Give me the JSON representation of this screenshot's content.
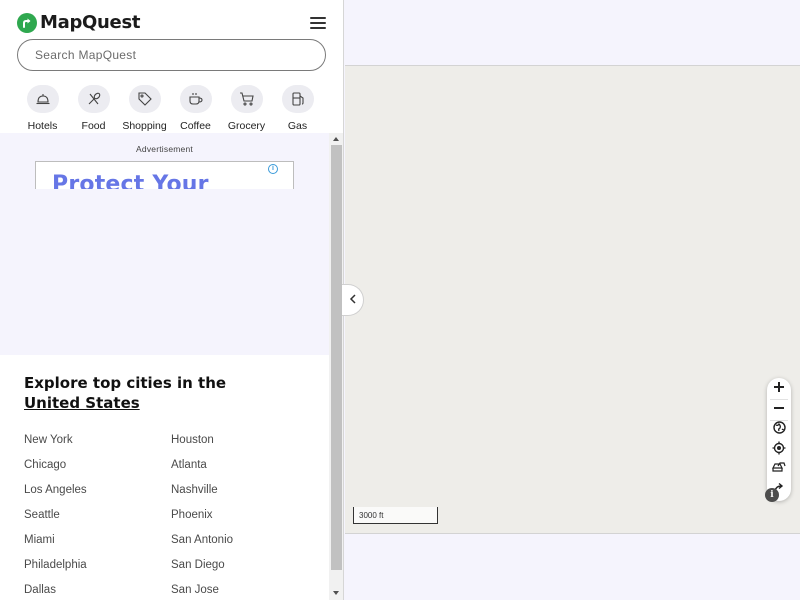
{
  "brand": {
    "name": "MapQuest",
    "color": "#2fa84f"
  },
  "search": {
    "placeholder": "Search MapQuest"
  },
  "categories": [
    {
      "label": "Hotels",
      "icon": "bell-icon"
    },
    {
      "label": "Food",
      "icon": "utensils-icon"
    },
    {
      "label": "Shopping",
      "icon": "tag-icon"
    },
    {
      "label": "Coffee",
      "icon": "coffee-cup-icon"
    },
    {
      "label": "Grocery",
      "icon": "cart-icon"
    },
    {
      "label": "Gas",
      "icon": "fuel-pump-icon"
    }
  ],
  "ad": {
    "label": "Advertisement",
    "headline": "Protect Your",
    "info": "i"
  },
  "explore": {
    "title": "Explore top cities in the",
    "country": "United States"
  },
  "cities": [
    "New York",
    "Houston",
    "Chicago",
    "Atlanta",
    "Los Angeles",
    "Nashville",
    "Seattle",
    "Phoenix",
    "Miami",
    "San Antonio",
    "Philadelphia",
    "San Diego",
    "Dallas",
    "San Jose"
  ],
  "map": {
    "scale_label": "3000 ft",
    "info": "i",
    "controls": [
      "zoom-in-icon",
      "zoom-out-icon",
      "globe-icon",
      "locate-icon",
      "traffic-icon",
      "share-icon"
    ]
  },
  "colors": {
    "map_background": "#eeede9",
    "panel_background": "#f5f4fd",
    "ad_headline": "#6676e6"
  }
}
